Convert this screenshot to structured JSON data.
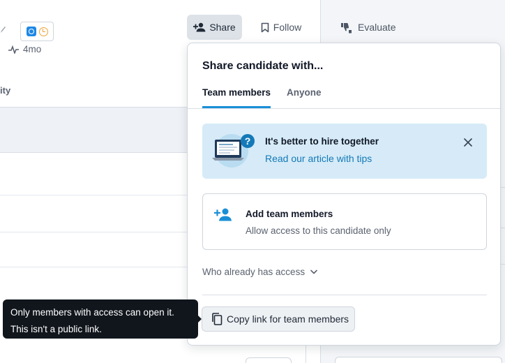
{
  "header": {
    "activity_age": "4mo",
    "column_fragment": "ity",
    "share_label": "Share",
    "follow_label": "Follow",
    "evaluate_label": "Evaluate"
  },
  "share_popover": {
    "title": "Share candidate with...",
    "tabs": [
      {
        "label": "Team members",
        "active": true
      },
      {
        "label": "Anyone",
        "active": false
      }
    ],
    "tip": {
      "title": "It's better to hire together",
      "link": "Read our article with tips"
    },
    "add_members": {
      "title": "Add team members",
      "subtitle": "Allow access to this candidate only"
    },
    "who_has_access": "Who already has access",
    "copy_link_label": "Copy link for team members"
  },
  "tooltip": {
    "line1": "Only members with access can open it.",
    "line2": "This isn't a public link."
  },
  "icons": {
    "share": "person-add-icon",
    "follow": "bookmark-icon",
    "evaluate": "thumbs-up-down-icon",
    "tip_close": "close-icon",
    "add_members": "person-add-icon",
    "who_access": "chevron-down-icon",
    "copy": "copy-icon"
  },
  "colors": {
    "accent": "#1a8fd6",
    "link": "#1479b8",
    "tip_background": "#d6ebf7",
    "tooltip_background": "#11161d"
  }
}
